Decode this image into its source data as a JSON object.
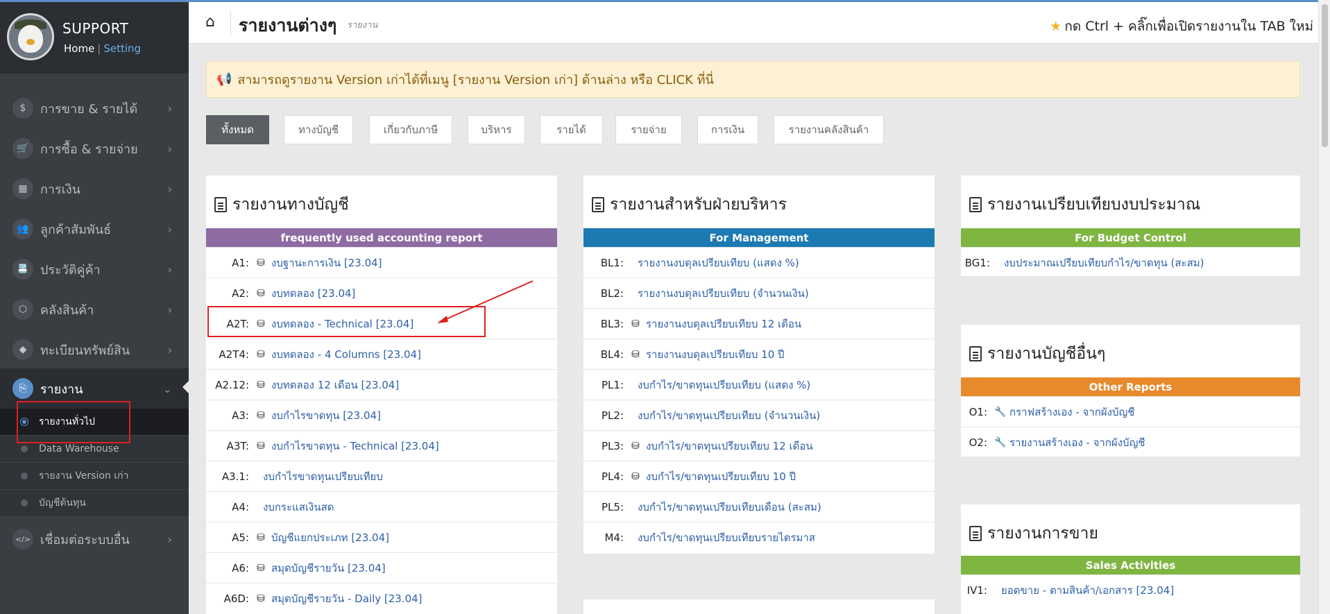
{
  "sidebar": {
    "title": "SUPPORT",
    "home": "Home",
    "divider": "|",
    "setting": "Setting",
    "menu": [
      {
        "label": "การขาย & รายได้",
        "icon": "$"
      },
      {
        "label": "การซื้อ & รายจ่าย",
        "icon": "🛒"
      },
      {
        "label": "การเงิน",
        "icon": "▦"
      },
      {
        "label": "ลูกค้าสัมพันธ์",
        "icon": "👥"
      },
      {
        "label": "ประวัติคู่ค้า",
        "icon": "📇"
      },
      {
        "label": "คลังสินค้า",
        "icon": "⬡"
      },
      {
        "label": "ทะเบียนทรัพย์สิน",
        "icon": "◆"
      },
      {
        "label": "รายงาน",
        "icon": "⎘"
      },
      {
        "label": "เชื่อมต่อระบบอื่น",
        "icon": "</>"
      }
    ],
    "submenu": [
      "รายงานทั่วไป",
      "Data Warehouse",
      "รายงาน Version เก่า",
      "บัญชีต้นทุน"
    ],
    "chevron_right": "›",
    "chevron_down": "⌄"
  },
  "header": {
    "title": "รายงานต่างๆ",
    "subtitle": "รายงาน",
    "tip": "กด Ctrl + คลิ๊กเพื่อเปิดรายงานใน TAB ใหม่",
    "home_icon": "⌂",
    "star_icon": "★"
  },
  "notice": {
    "icon": "📢",
    "text": "สามารถดูรายงาน Version เก่าได้ที่เมนู [รายงาน Version เก่า] ด้านล่าง หรือ CLICK ที่นี่"
  },
  "filters": [
    "ทั้งหมด",
    "ทางบัญชี",
    "เกี่ยวกับภาษี",
    "บริหาร",
    "รายได้",
    "รายจ่าย",
    "การเงิน",
    "รายงานคลังสินค้า"
  ],
  "panels": {
    "accounting": {
      "title": "รายงานทางบัญชี",
      "band": "frequently used accounting report",
      "band_color": "#8e6ba3",
      "rows": [
        {
          "code": "A1:",
          "text": "งบฐานะการเงิน [23.04]",
          "icon": "db"
        },
        {
          "code": "A2:",
          "text": "งบทดลอง [23.04]",
          "icon": "db"
        },
        {
          "code": "A2T:",
          "text": "งบทดลอง - Technical [23.04]",
          "icon": "db"
        },
        {
          "code": "A2T4:",
          "text": "งบทดลอง - 4 Columns [23.04]",
          "icon": "db"
        },
        {
          "code": "A2.12:",
          "text": "งบทดลอง 12 เดือน [23.04]",
          "icon": "db"
        },
        {
          "code": "A3:",
          "text": "งบกำไรขาดทุน [23.04]",
          "icon": "db"
        },
        {
          "code": "A3T:",
          "text": "งบกำไรขาดทุน - Technical [23.04]",
          "icon": "db"
        },
        {
          "code": "A3.1:",
          "text": "งบกำไรขาดทุนเปรียบเทียบ",
          "icon": ""
        },
        {
          "code": "A4:",
          "text": "งบกระแสเงินสด",
          "icon": ""
        },
        {
          "code": "A5:",
          "text": "บัญชีแยกประเภท [23.04]",
          "icon": "db"
        },
        {
          "code": "A6:",
          "text": "สมุดบัญชีรายวัน [23.04]",
          "icon": "db"
        },
        {
          "code": "A6D:",
          "text": "สมุดบัญชีรายวัน - Daily [23.04]",
          "icon": "db"
        }
      ]
    },
    "management": {
      "title": "รายงานสำหรับฝ่ายบริหาร",
      "band": "For Management",
      "band_color": "#1c7ab1",
      "rows": [
        {
          "code": "BL1:",
          "text": "รายงานงบดุลเปรียบเทียบ (แสดง %)",
          "icon": ""
        },
        {
          "code": "BL2:",
          "text": "รายงานงบดุลเปรียบเทียบ (จำนวนเงิน)",
          "icon": ""
        },
        {
          "code": "BL3:",
          "text": "รายงานงบดุลเปรียบเทียบ 12 เดือน",
          "icon": "db"
        },
        {
          "code": "BL4:",
          "text": "รายงานงบดุลเปรียบเทียบ 10 ปี",
          "icon": "db"
        },
        {
          "code": "PL1:",
          "text": "งบกำไร/ขาดทุนเปรียบเทียบ (แสดง %)",
          "icon": ""
        },
        {
          "code": "PL2:",
          "text": "งบกำไร/ขาดทุนเปรียบเทียบ (จำนวนเงิน)",
          "icon": ""
        },
        {
          "code": "PL3:",
          "text": "งบกำไร/ขาดทุนเปรียบเทียบ 12 เดือน",
          "icon": "db"
        },
        {
          "code": "PL4:",
          "text": "งบกำไร/ขาดทุนเปรียบเทียบ 10 ปี",
          "icon": "db"
        },
        {
          "code": "PL5:",
          "text": "งบกำไร/ขาดทุนเปรียบเทียบเดือน (สะสม)",
          "icon": ""
        },
        {
          "code": "M4:",
          "text": "งบกำไร/ขาดทุนเปรียบเทียบรายไตรมาส",
          "icon": ""
        }
      ]
    },
    "budget": {
      "title": "รายงานเปรียบเทียบงบประมาณ",
      "band": "For Budget Control",
      "band_color": "#7fb541",
      "rows": [
        {
          "code": "BG1:",
          "text": "งบประมาณเปรียบเทียบกำไร/ขาดทุน (สะสม)",
          "icon": ""
        }
      ]
    },
    "other": {
      "title": "รายงานบัญชีอื่นๆ",
      "band": "Other Reports",
      "band_color": "#e8892b",
      "rows": [
        {
          "code": "O1:",
          "text": "กราฟสร้างเอง - จากผังบัญชี",
          "icon": "wrench"
        },
        {
          "code": "O2:",
          "text": "รายงานสร้างเอง - จากผังบัญชี",
          "icon": "wrench"
        }
      ]
    },
    "sales": {
      "title": "รายงานการขาย",
      "band": "Sales Activities",
      "band_color": "#7fb541",
      "rows": [
        {
          "code": "IV1:",
          "text": "ยอดขาย - ตามสินค้า/เอกสาร [23.04]",
          "icon": ""
        }
      ]
    }
  },
  "icons": {
    "db": "⛁",
    "wrench": "🔧"
  },
  "colors": {
    "link": "#2d5fa8",
    "accent": "#5b8fc7",
    "highlight": "#e02020"
  }
}
